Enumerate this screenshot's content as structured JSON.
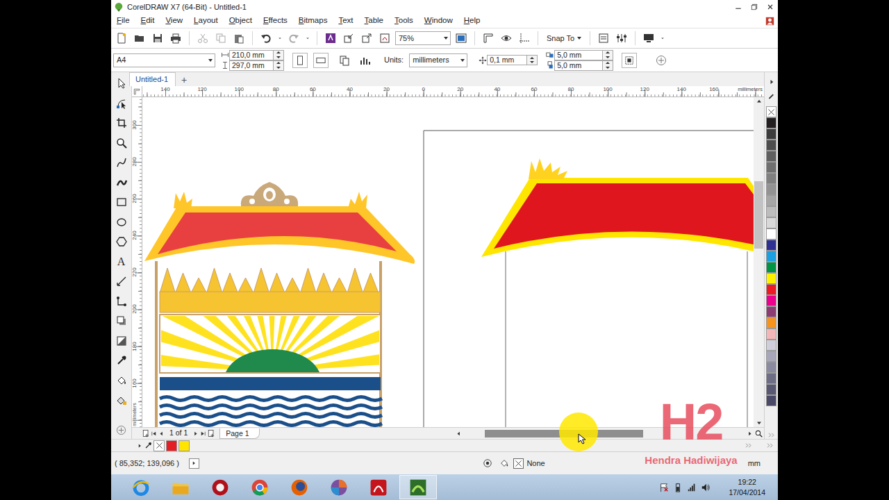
{
  "window": {
    "title": "CorelDRAW X7 (64-Bit) - Untitled-1"
  },
  "menu": [
    "File",
    "Edit",
    "View",
    "Layout",
    "Object",
    "Effects",
    "Bitmaps",
    "Text",
    "Table",
    "Tools",
    "Window",
    "Help"
  ],
  "toolbar": {
    "zoom": "75%",
    "snap": "Snap To"
  },
  "property_bar": {
    "page_size": "A4",
    "width": "210,0 mm",
    "height": "297,0 mm",
    "units_label": "Units:",
    "units": "millimeters",
    "nudge": "0,1 mm",
    "duplicate_x": "5,0 mm",
    "duplicate_y": "5,0 mm"
  },
  "doc_tabs": [
    {
      "label": "Untitled-1",
      "selected": true
    }
  ],
  "new_tab": "+",
  "toolbox": {
    "text_tool": "A"
  },
  "rulers": {
    "horizontal": [
      "140",
      "120",
      "100",
      "80",
      "60",
      "40",
      "20",
      "0",
      "20",
      "40",
      "60",
      "80",
      "100",
      "120",
      "140",
      "160"
    ],
    "vertical": [
      "300",
      "280",
      "260",
      "240",
      "220",
      "200",
      "180",
      "160"
    ],
    "unit": "millimeters"
  },
  "page_nav": {
    "count": "1 of 1",
    "pages": [
      {
        "label": "Page 1",
        "selected": true
      }
    ]
  },
  "palette": [
    {
      "kind": "none",
      "color": "#ffffff"
    },
    {
      "kind": "swatch",
      "color": "#231f20"
    },
    {
      "kind": "swatch",
      "color": "#3c3c3c"
    },
    {
      "kind": "swatch",
      "color": "#4d4d4d"
    },
    {
      "kind": "swatch",
      "color": "#5f5f5f"
    },
    {
      "kind": "swatch",
      "color": "#6f6f6f"
    },
    {
      "kind": "swatch",
      "color": "#808080"
    },
    {
      "kind": "swatch",
      "color": "#939393"
    },
    {
      "kind": "swatch",
      "color": "#a6a6a6"
    },
    {
      "kind": "swatch",
      "color": "#bcbcbc"
    },
    {
      "kind": "swatch",
      "color": "#d9d9d9"
    },
    {
      "kind": "swatch",
      "color": "#ffffff"
    },
    {
      "kind": "swatch",
      "color": "#2e3192"
    },
    {
      "kind": "swatch",
      "color": "#1ba1e2"
    },
    {
      "kind": "swatch",
      "color": "#009444"
    },
    {
      "kind": "swatch",
      "color": "#fff200"
    },
    {
      "kind": "swatch",
      "color": "#ed1c24"
    },
    {
      "kind": "swatch",
      "color": "#ec008c"
    },
    {
      "kind": "swatch",
      "color": "#8c3c72"
    },
    {
      "kind": "swatch",
      "color": "#f7941d"
    },
    {
      "kind": "swatch",
      "color": "#f4b6b6"
    },
    {
      "kind": "swatch",
      "color": "#cfcfdc"
    },
    {
      "kind": "swatch",
      "color": "#a7a7b9"
    },
    {
      "kind": "swatch",
      "color": "#8a8aa0"
    },
    {
      "kind": "swatch",
      "color": "#6d6d85"
    },
    {
      "kind": "swatch",
      "color": "#585873"
    },
    {
      "kind": "swatch",
      "color": "#4a4a68"
    }
  ],
  "document_palette": [
    {
      "kind": "none",
      "color": "#ffffff"
    },
    {
      "kind": "swatch",
      "color": "#e31e24"
    },
    {
      "kind": "swatch",
      "color": "#ffe500"
    }
  ],
  "status_bar": {
    "coords": "( 85,352; 139,096 )",
    "fill": "None",
    "outline_unit": "mm"
  },
  "watermark": {
    "logo": "H2",
    "name": "Hendra Hadiwijaya"
  },
  "taskbar": {
    "time": "19:22",
    "date": "17/04/2014"
  }
}
